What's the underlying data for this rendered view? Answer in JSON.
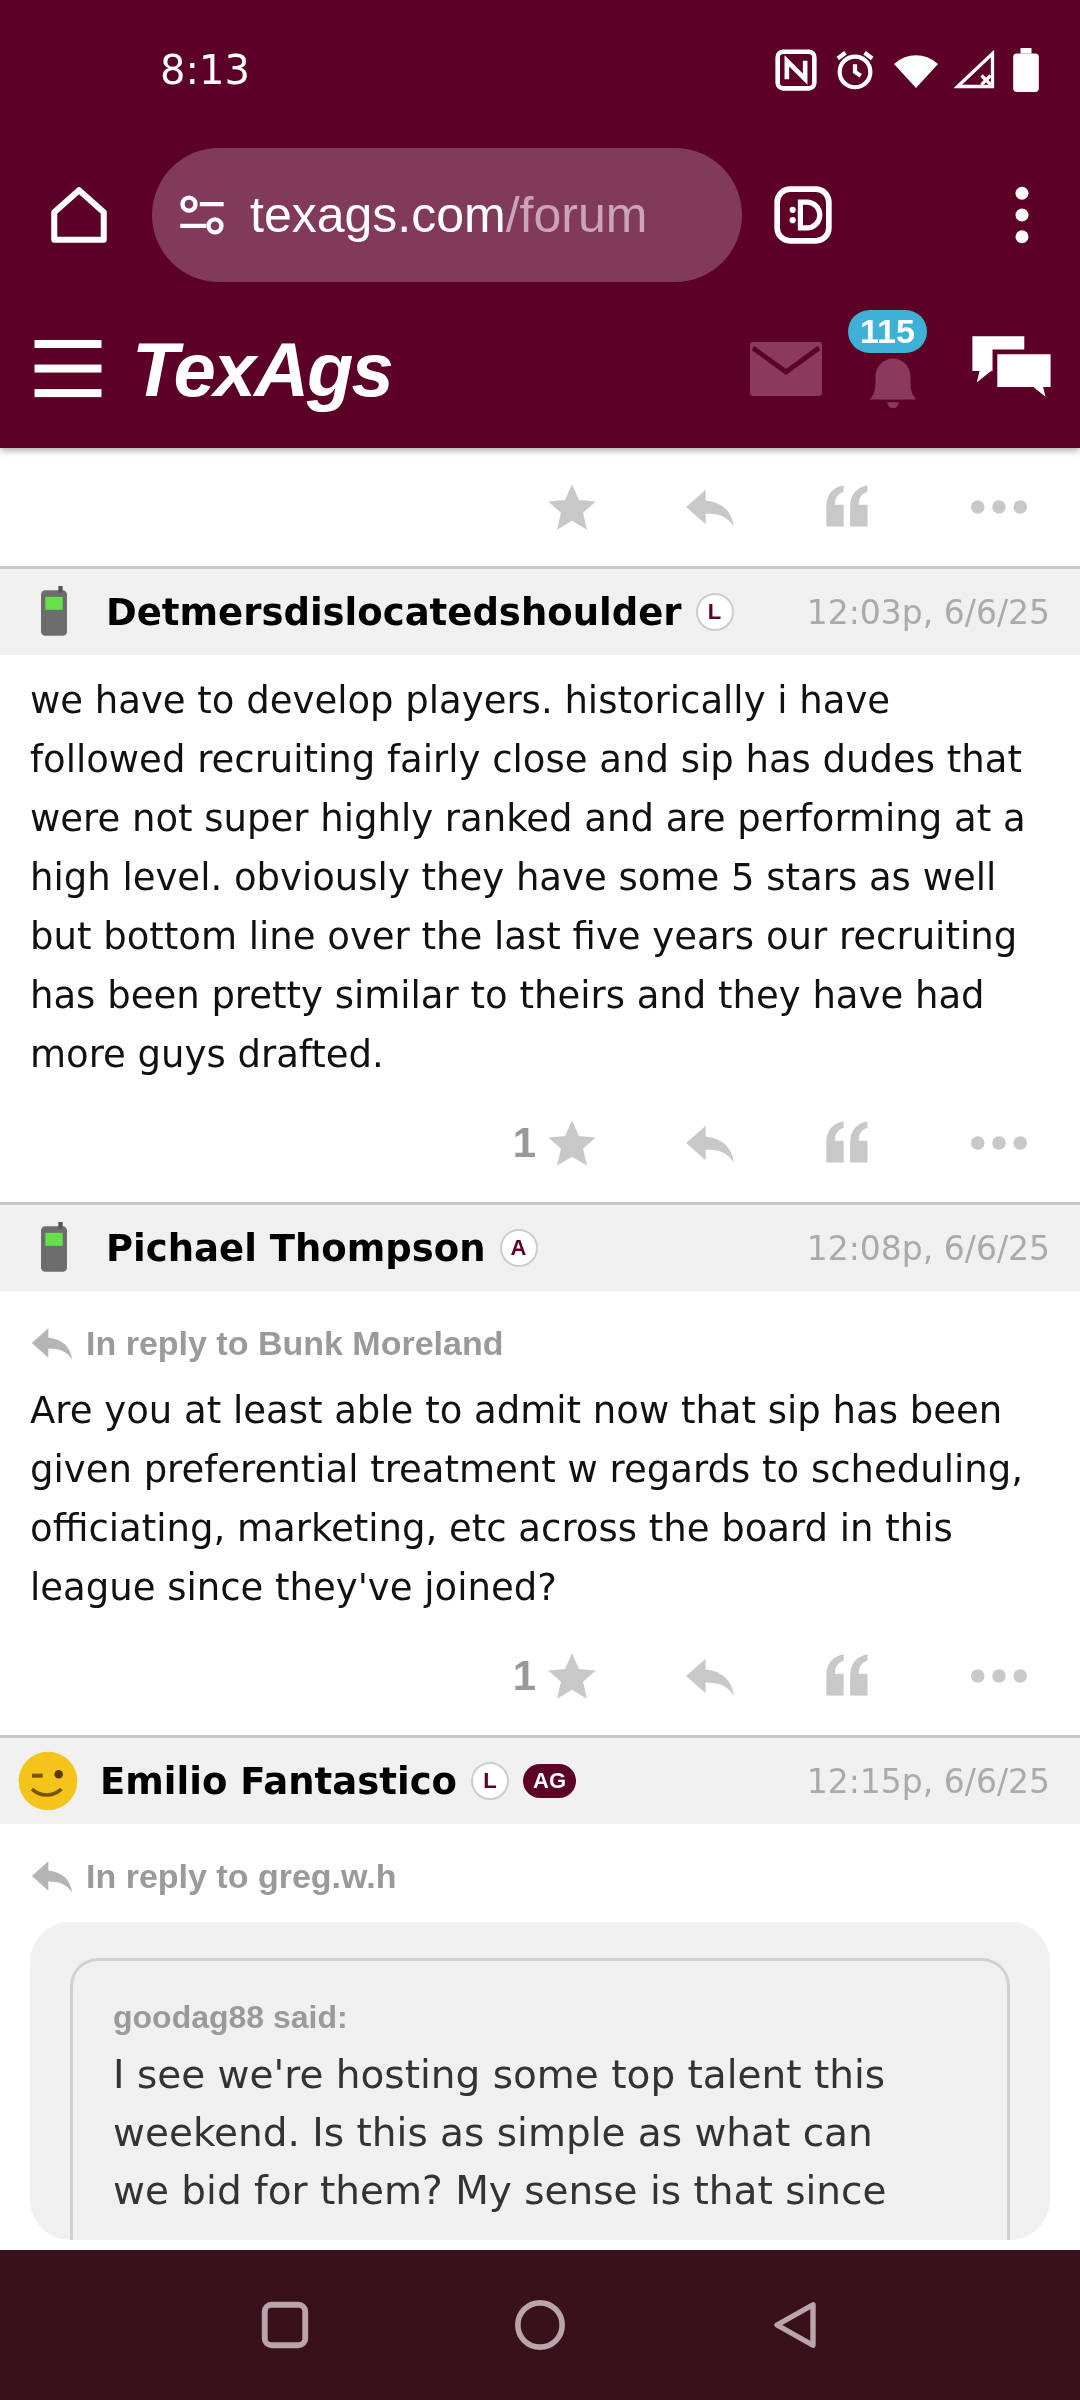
{
  "status_bar": {
    "time": "8:13"
  },
  "browser": {
    "url_host": "texags.com",
    "url_path": "/forum"
  },
  "site_header": {
    "logo": "TexAgs",
    "notification_count": "115"
  },
  "posts": [
    {
      "avatar": {
        "kind": "phone"
      },
      "author": "Detmersdislocatedshoulder",
      "badges": [
        {
          "label": "L",
          "kind": "outline"
        }
      ],
      "time": "12:03p, 6/6/25",
      "body": "we have to develop players. historically i have followed recruiting fairly close and sip has dudes that were not super highly ranked and are performing at a high level. obviously they have some 5 stars as well but bottom line over the last five years our recruiting has been pretty similar to theirs and they have had more guys drafted.",
      "star_count": "1"
    },
    {
      "avatar": {
        "kind": "phone"
      },
      "author": "Pichael Thompson",
      "badges": [
        {
          "label": "A",
          "kind": "outline"
        }
      ],
      "time": "12:08p, 6/6/25",
      "in_reply_to": "In reply to Bunk Moreland",
      "body": "Are you at least able to admit now that sip has been given preferential treatment w regards to scheduling, officiating, marketing, etc across the board in this league since they've joined?",
      "star_count": "1"
    },
    {
      "avatar": {
        "kind": "smiley"
      },
      "author": "Emilio Fantastico",
      "badges": [
        {
          "label": "L",
          "kind": "outline"
        },
        {
          "label": "AG",
          "kind": "filled"
        }
      ],
      "time": "12:15p, 6/6/25",
      "in_reply_to": "In reply to greg.w.h",
      "quote": {
        "attribution": "goodag88 said:",
        "lines": [
          "I see we're hosting some top talent this",
          "weekend. Is this as simple as what can",
          "we bid for them? My sense is that since"
        ]
      }
    }
  ]
}
